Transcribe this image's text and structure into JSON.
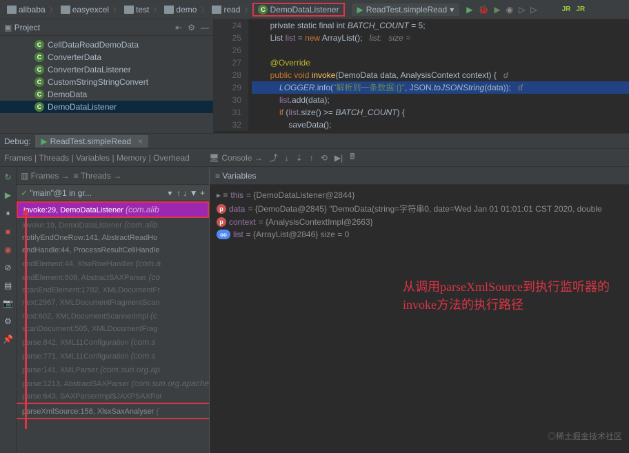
{
  "breadcrumb": [
    "alibaba",
    "easyexcel",
    "test",
    "demo",
    "read"
  ],
  "breadcrumb_class": "DemoDataListener",
  "run_config": "ReadTest.simpleRead",
  "project_panel_title": "Project",
  "project_tree": [
    {
      "label": "CellDataReadDemoData"
    },
    {
      "label": "ConverterData"
    },
    {
      "label": "ConverterDataListener"
    },
    {
      "label": "CustomStringStringConvert"
    },
    {
      "label": "DemoData"
    },
    {
      "label": "DemoDataListener",
      "selected": true
    }
  ],
  "editor": {
    "lines": [
      {
        "n": 24,
        "html": "        private static final int <i>BATCH_COUNT</i> = 5;"
      },
      {
        "n": 25,
        "html": "        List<DemoData> <span class=id>list</span> = <span class=kw>new</span> ArrayList<DemoData>();   <span class=com>list:   size =</span>"
      },
      {
        "n": 26,
        "html": ""
      },
      {
        "n": 27,
        "html": "        <span class=ann>@Override</span>"
      },
      {
        "n": 28,
        "html": "        <span class=kw>public void</span> <span class=fn>invoke</span>(DemoData data, AnalysisContext context) {   <span class=com>d</span>"
      },
      {
        "n": 29,
        "exec": true,
        "html": "            <i>LOGGER</i>.info(<span class=str>\"解析到一条数据:{}\"</span>, JSON.<i>toJSONString</i>(data));   <span class=com>d</span>"
      },
      {
        "n": 30,
        "html": "            <span class=id>list</span>.add(data);"
      },
      {
        "n": 31,
        "html": "            <span class=kw>if</span> (<span class=id>list</span>.size() >= <i>BATCH_COUNT</i>) {"
      },
      {
        "n": 32,
        "html": "                saveData();"
      }
    ]
  },
  "debug_label": "Debug:",
  "debug_tab": "ReadTest.simpleRead",
  "debug_toolbar_text": "Frames | Threads | Variables | Memory | Overhead",
  "console_label": "Console",
  "frames_label": "Frames",
  "threads_label": "Threads",
  "thread_selector": "\"main\"@1 in gr...",
  "stack": [
    {
      "text": "invoke:29, DemoDataListener",
      "pkg": "(com.alib",
      "active": true
    },
    {
      "text": "invoke:19, DemoDataListener",
      "pkg": "(com.alib",
      "dim": true
    },
    {
      "text": "notifyEndOneRow:141, AbstractReadHo"
    },
    {
      "text": "endHandle:44, ProcessResultCellHandle"
    },
    {
      "text": "endElement:44, XlsxRowHandler",
      "pkg": "(com.a",
      "dim": true
    },
    {
      "text": "endElement:609, AbstractSAXParser",
      "pkg": "(co",
      "dim": true
    },
    {
      "text": "scanEndElement:1782, XMLDocumentFr",
      "dim": true
    },
    {
      "text": "next:2967, XMLDocumentFragmentScan",
      "dim": true
    },
    {
      "text": "next:602, XMLDocumentScannerImpl",
      "pkg": "(c",
      "dim": true
    },
    {
      "text": "scanDocument:505, XMLDocumentFrag",
      "dim": true
    },
    {
      "text": "parse:842, XML11Configuration",
      "pkg": "(com.s",
      "dim": true
    },
    {
      "text": "parse:771, XML11Configuration",
      "pkg": "(com.s",
      "dim": true
    },
    {
      "text": "parse:141, XMLParser",
      "pkg": "(com.sun.org.ap",
      "dim": true
    },
    {
      "text": "parse:1213, AbstractSAXParser",
      "pkg": "(com.sun.org.apache.xerces.internal.parsers)",
      "dim": true
    },
    {
      "text": "parse:643, SAXParserImpl$JAXPSAXPar",
      "dim": true
    },
    {
      "text": "parseXmlSource:158, XlsxSaxAnalyser",
      "pkg": "(",
      "bottom": true
    }
  ],
  "vars_label": "Variables",
  "variables": [
    {
      "kind": "this",
      "name": "this",
      "val": "= {DemoDataListener@2844}"
    },
    {
      "kind": "p",
      "name": "data",
      "val": "= {DemoData@2845} \"DemoData(string=字符串0, date=Wed Jan 01 01:01:01 CST 2020, double"
    },
    {
      "kind": "p",
      "name": "context",
      "val": "= {AnalysisContextImpl@2663}"
    },
    {
      "kind": "oo",
      "name": "list",
      "val": "= {ArrayList@2846}  size = 0"
    }
  ],
  "annotation_text": "从调用parseXmlSource到执行监听器的invoke方法的执行路径",
  "watermark": "◎稀土掘金技术社区"
}
